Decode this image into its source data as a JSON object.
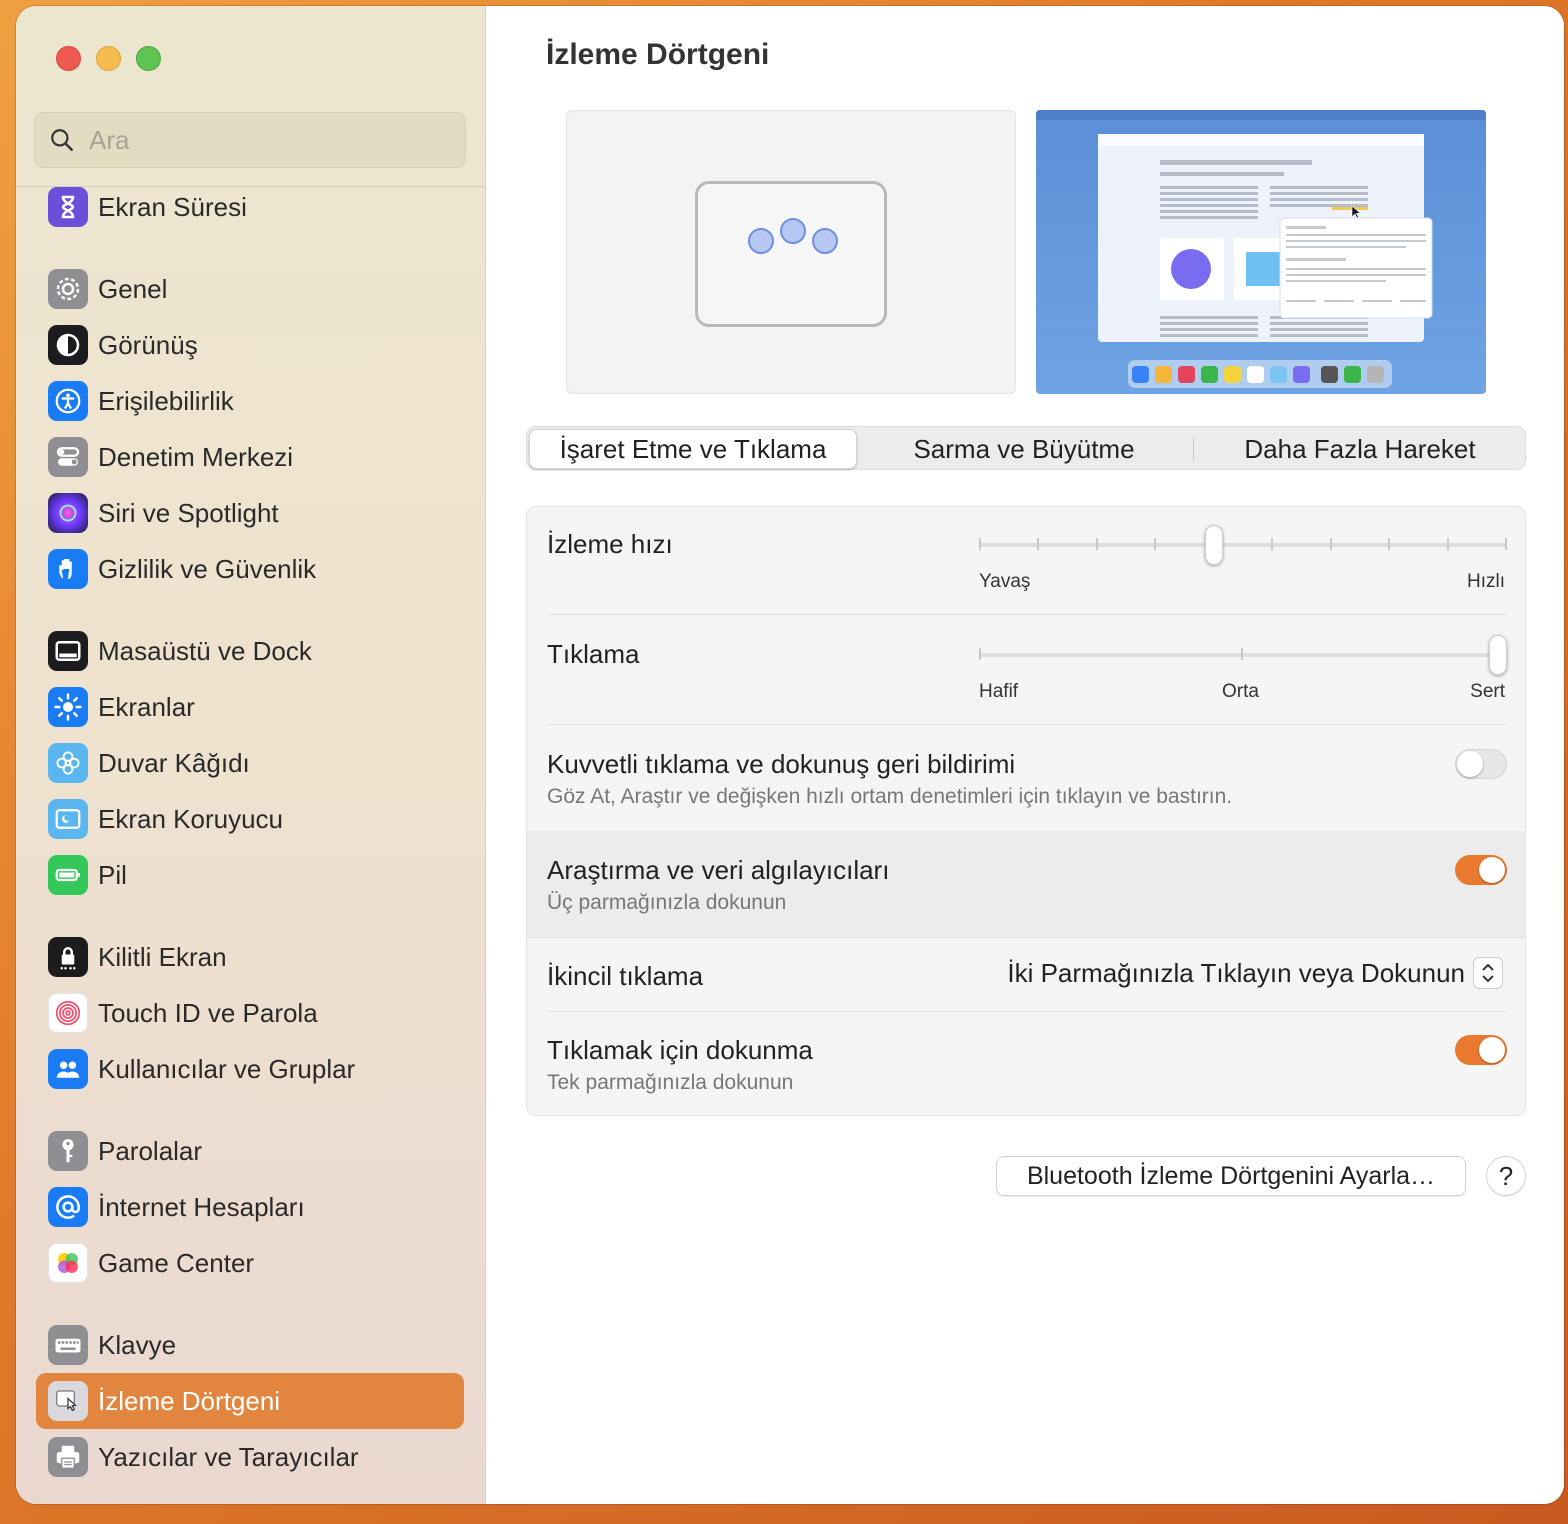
{
  "search": {
    "placeholder": "Ara"
  },
  "sidebar": {
    "items": [
      {
        "label": "Ekran Süresi",
        "icon": "hourglass-icon"
      },
      {
        "label": "Genel",
        "icon": "gear-icon"
      },
      {
        "label": "Görünüş",
        "icon": "appearance-icon"
      },
      {
        "label": "Erişilebilirlik",
        "icon": "accessibility-icon"
      },
      {
        "label": "Denetim Merkezi",
        "icon": "control-center-icon"
      },
      {
        "label": "Siri ve Spotlight",
        "icon": "siri-icon"
      },
      {
        "label": "Gizlilik ve Güvenlik",
        "icon": "hand-icon"
      },
      {
        "label": "Masaüstü ve Dock",
        "icon": "dock-icon"
      },
      {
        "label": "Ekranlar",
        "icon": "sun-icon"
      },
      {
        "label": "Duvar Kâğıdı",
        "icon": "flower-icon"
      },
      {
        "label": "Ekran Koruyucu",
        "icon": "screensaver-icon"
      },
      {
        "label": "Pil",
        "icon": "battery-icon"
      },
      {
        "label": "Kilitli Ekran",
        "icon": "lock-icon"
      },
      {
        "label": "Touch ID ve Parola",
        "icon": "fingerprint-icon"
      },
      {
        "label": "Kullanıcılar ve Gruplar",
        "icon": "users-icon"
      },
      {
        "label": "Parolalar",
        "icon": "key-icon"
      },
      {
        "label": "İnternet Hesapları",
        "icon": "at-icon"
      },
      {
        "label": "Game Center",
        "icon": "game-center-icon"
      },
      {
        "label": "Klavye",
        "icon": "keyboard-icon"
      },
      {
        "label": "İzleme Dörtgeni",
        "icon": "trackpad-icon",
        "active": true
      },
      {
        "label": "Yazıcılar ve Tarayıcılar",
        "icon": "printer-icon"
      }
    ]
  },
  "main": {
    "title": "İzleme Dörtgeni",
    "tabs": [
      {
        "label": "İşaret Etme ve Tıklama",
        "active": true
      },
      {
        "label": "Sarma ve Büyütme"
      },
      {
        "label": "Daha Fazla Hareket"
      }
    ],
    "tracking_speed": {
      "label": "İzleme hızı",
      "min_label": "Yavaş",
      "max_label": "Hızlı",
      "steps": 10,
      "value_index": 4
    },
    "click": {
      "label": "Tıklama",
      "labels": [
        "Hafif",
        "Orta",
        "Sert"
      ],
      "value_index": 2
    },
    "force_click": {
      "label": "Kuvvetli tıklama ve dokunuş geri bildirimi",
      "sub": "Göz At, Araştır ve değişken hızlı ortam denetimleri için tıklayın ve bastırın.",
      "on": false
    },
    "lookup": {
      "label": "Araştırma ve veri algılayıcıları",
      "sub": "Üç parmağınızla dokunun",
      "on": true
    },
    "secondary_click": {
      "label": "İkincil tıklama",
      "value": "İki Parmağınızla Tıklayın veya Dokunun"
    },
    "tap_to_click": {
      "label": "Tıklamak için dokunma",
      "sub": "Tek parmağınızla dokunun",
      "on": true
    },
    "bluetooth_button": "Bluetooth İzleme Dörtgenini Ayarla…",
    "help_button": "?"
  },
  "colors": {
    "accent": "#e8792e",
    "active_sidebar": "#e2853e"
  }
}
